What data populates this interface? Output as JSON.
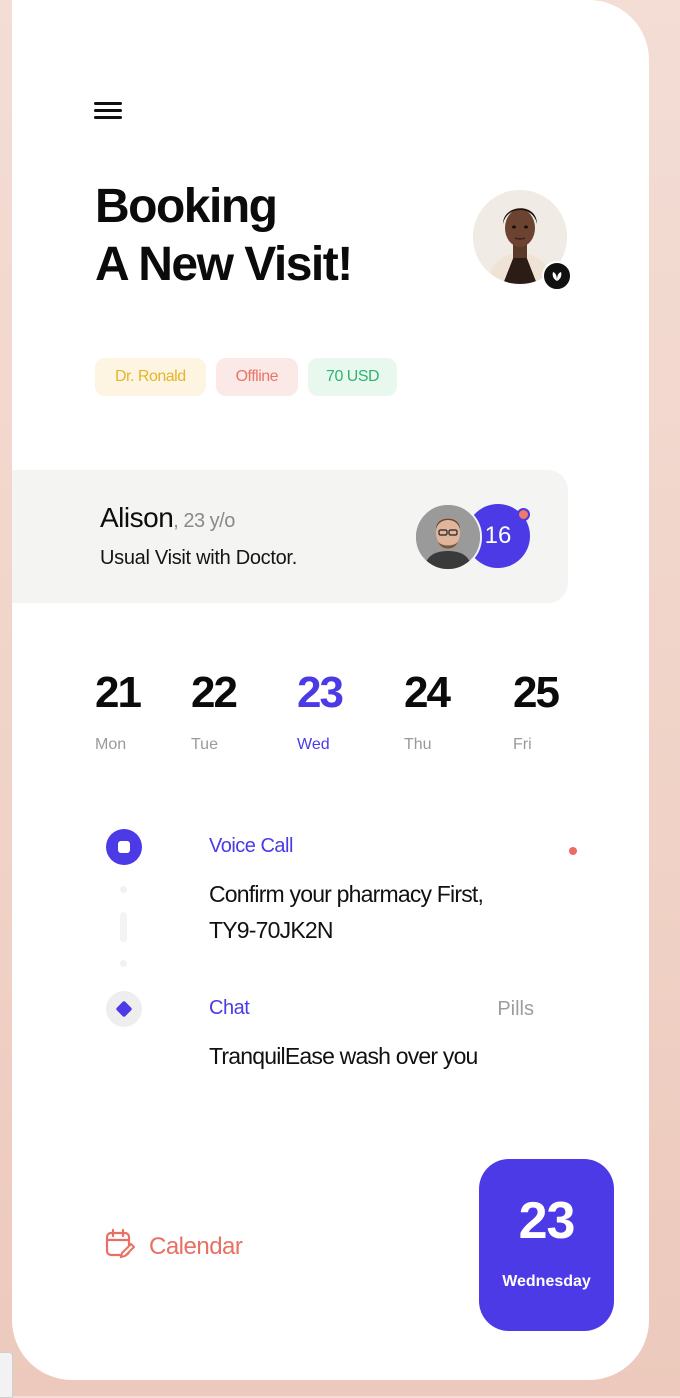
{
  "header": {
    "title_line1": "Booking",
    "title_line2": "A New Visit!"
  },
  "tags": [
    {
      "label": "Dr. Ronald"
    },
    {
      "label": "Offline"
    },
    {
      "label": "70 USD"
    }
  ],
  "patient": {
    "name": "Alison",
    "age": ", 23 y/o",
    "description": "Usual Visit with Doctor.",
    "count": "16"
  },
  "days": [
    {
      "num": "21",
      "label": "Mon"
    },
    {
      "num": "22",
      "label": "Tue"
    },
    {
      "num": "23",
      "label": "Wed",
      "selected": true
    },
    {
      "num": "24",
      "label": "Thu"
    },
    {
      "num": "25",
      "label": "Fri"
    }
  ],
  "activities": [
    {
      "type": "Voice Call",
      "text_line1": "Confirm your pharmacy First,",
      "text_line2": "TY9-70JK2N",
      "icon": "stop-icon"
    },
    {
      "type": "Chat",
      "text_line1": "TranquilEase wash over you",
      "side_label": "Pills",
      "icon": "diamond-icon"
    }
  ],
  "footer": {
    "calendar_label": "Calendar",
    "date_number": "23",
    "date_day": "Wednesday"
  },
  "colors": {
    "accent": "#4b3ae6",
    "coral": "#ea6f63"
  }
}
